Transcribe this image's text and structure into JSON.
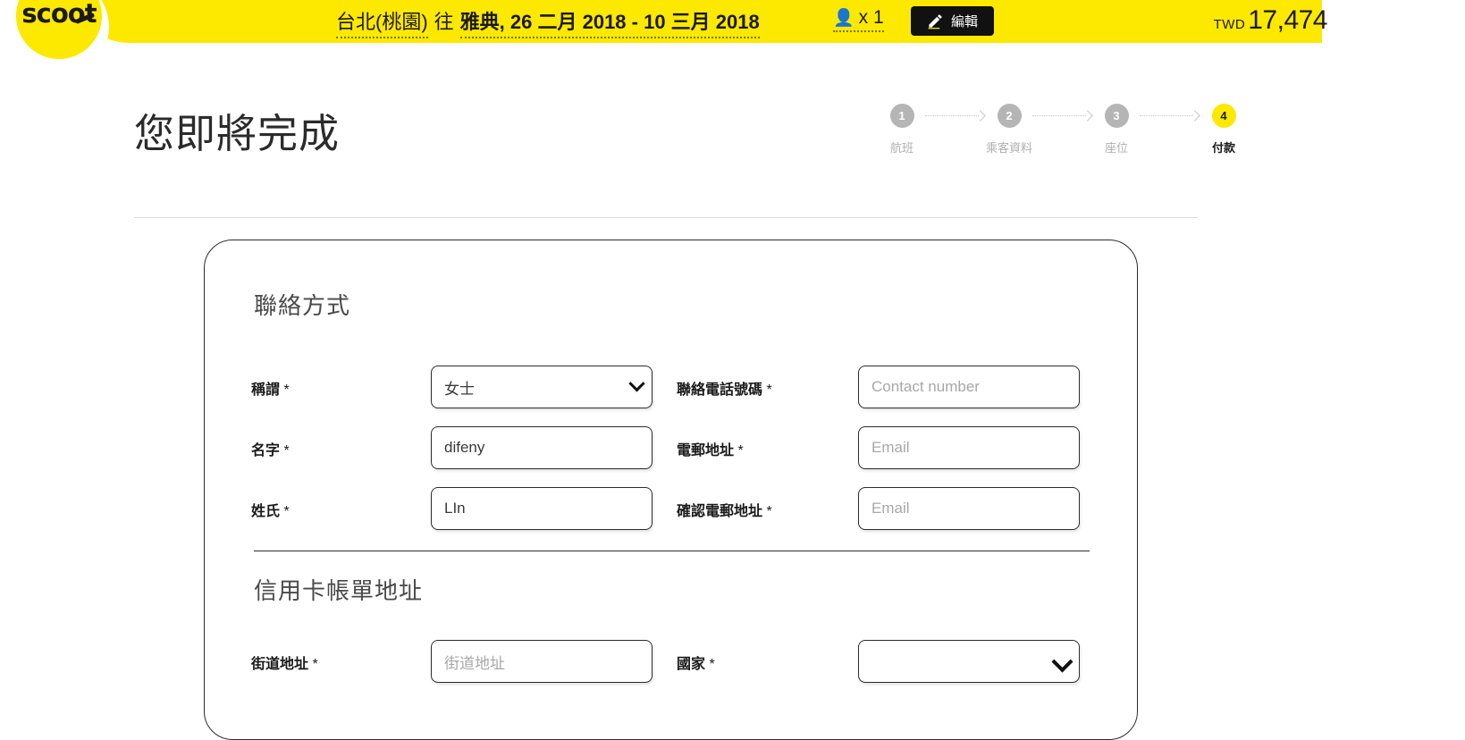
{
  "header": {
    "logo_text": "scoot",
    "trip": {
      "origin": "台北(桃園)",
      "to_word": "往",
      "destination_and_dates": "雅典, 26 二月 2018 - 10 三月 2018"
    },
    "passenger_icon": "person-icon",
    "passenger_count": "x 1",
    "edit_button_label": "編輯",
    "edit_icon": "pencil-icon",
    "currency": "TWD",
    "price": "17,474",
    "price_chevron_icon": "chevron-down-icon"
  },
  "page": {
    "title": "您即將完成"
  },
  "steps": [
    {
      "number": "1",
      "label": "航班",
      "active": false
    },
    {
      "number": "2",
      "label": "乘客資料",
      "active": false
    },
    {
      "number": "3",
      "label": "座位",
      "active": false
    },
    {
      "number": "4",
      "label": "付款",
      "active": true
    }
  ],
  "card": {
    "contact_section": {
      "title": "聯絡方式",
      "fields": {
        "title_label": "稱謂",
        "title_required": "*",
        "title_value": "女士",
        "first_name_label": "名字",
        "first_name_required": "*",
        "first_name_value": "difeny",
        "last_name_label": "姓氏",
        "last_name_required": "*",
        "last_name_value": "LIn",
        "phone_label": "聯絡電話號碼",
        "phone_required": "*",
        "phone_placeholder": "Contact number",
        "email_label": "電郵地址",
        "email_required": "*",
        "email_placeholder": "Email",
        "confirm_email_label": "確認電郵地址",
        "confirm_email_required": "*",
        "confirm_email_placeholder": "Email"
      }
    },
    "billing_section": {
      "title": "信用卡帳單地址",
      "fields": {
        "street_label": "街道地址",
        "street_required": "*",
        "street_placeholder": "街道地址",
        "country_label": "國家",
        "country_required": "*",
        "country_value": ""
      }
    }
  },
  "colors": {
    "brand_yellow": "#fde800",
    "black": "#111111",
    "step_inactive": "#b5b5b5"
  }
}
